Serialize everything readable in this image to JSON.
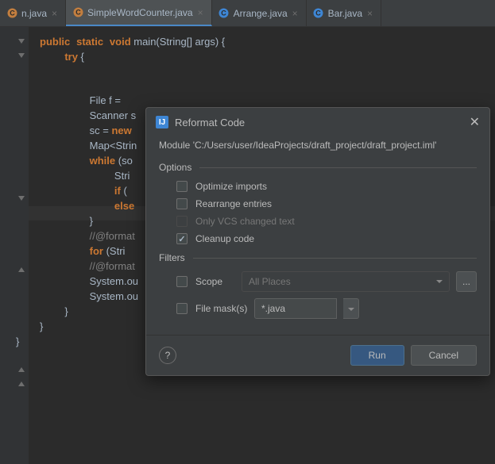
{
  "tabs": [
    {
      "label": "n.java",
      "active": false,
      "icon_color": "#c27e3f"
    },
    {
      "label": "SimpleWordCounter.java",
      "active": true,
      "icon_color": "#c27e3f"
    },
    {
      "label": "Arrange.java",
      "active": false,
      "icon_color": "#3e86d4"
    },
    {
      "label": "Bar.java",
      "active": false,
      "icon_color": "#3e86d4"
    }
  ],
  "code": {
    "l1a": "public",
    "l1b": "static",
    "l1c": "void",
    "l1d": " main(String[] args) {",
    "l2a": "try",
    "l2b": " {",
    "l3": "File f = ",
    "l4": "Scanner s",
    "l5a": "sc = ",
    "l5b": "new",
    "l6": "Map<Strin",
    "l7a": "while",
    "l7b": " (so",
    "l8": "Stri",
    "l9a": "if",
    "l9b": " (",
    "l10": "else",
    "l11": "}",
    "l12": "//@format",
    "l13a": "for",
    "l13b": " (Stri",
    "l14": "//@format",
    "l15": "System.ou",
    "l16": "System.ou",
    "l17": "}",
    "l18": "}",
    "l19": "}"
  },
  "dialog": {
    "title": "Reformat Code",
    "module": "Module 'C:/Users/user/IdeaProjects/draft_project/draft_project.iml'",
    "options_title": "Options",
    "optimize": "Optimize imports",
    "rearrange": "Rearrange entries",
    "vcs": "Only VCS changed text",
    "cleanup": "Cleanup code",
    "filters_title": "Filters",
    "scope_label": "Scope",
    "scope_value": "All Places",
    "filemask_label": "File mask(s)",
    "filemask_value": "*.java",
    "ellipsis": "...",
    "help": "?",
    "run": "Run",
    "cancel": "Cancel",
    "close": "✕",
    "icon_letter": "IJ"
  }
}
